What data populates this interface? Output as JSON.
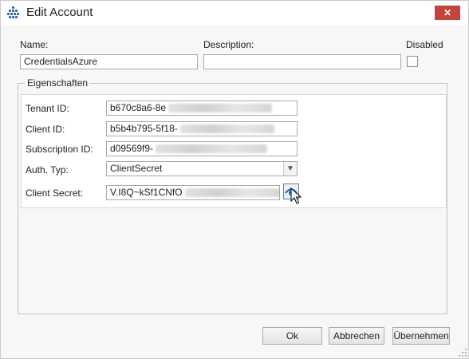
{
  "window": {
    "title": "Edit Account",
    "close_glyph": "✕"
  },
  "fields": {
    "name_label": "Name:",
    "name_value": "CredentialsAzure",
    "description_label": "Description:",
    "description_value": "",
    "disabled_label": "Disabled",
    "disabled_checked": false
  },
  "group": {
    "legend": "Eigenschaften",
    "tenant_label": "Tenant ID:",
    "tenant_value": "b670c8a6-8e",
    "client_label": "Client ID:",
    "client_value": "b5b4b795-5f18-",
    "subscription_label": "Subscription ID:",
    "subscription_value": "d09569f9-",
    "authtype_label": "Auth. Typ:",
    "authtype_value": "ClientSecret",
    "secret_label": "Client Secret:",
    "secret_value": "V.I8Q~kSf1CNfO"
  },
  "buttons": {
    "ok": "Ok",
    "cancel": "Abbrechen",
    "apply": "Übernehmen"
  },
  "icons": {
    "app": "grid-dots-icon",
    "dropdown": "chevron-down-icon",
    "reveal": "eye-icon",
    "pointer": "mouse-pointer-icon"
  },
  "colors": {
    "close_button": "#c7423a",
    "app_icon": "#2a5fa8",
    "eye_icon": "#1f6fb5"
  }
}
